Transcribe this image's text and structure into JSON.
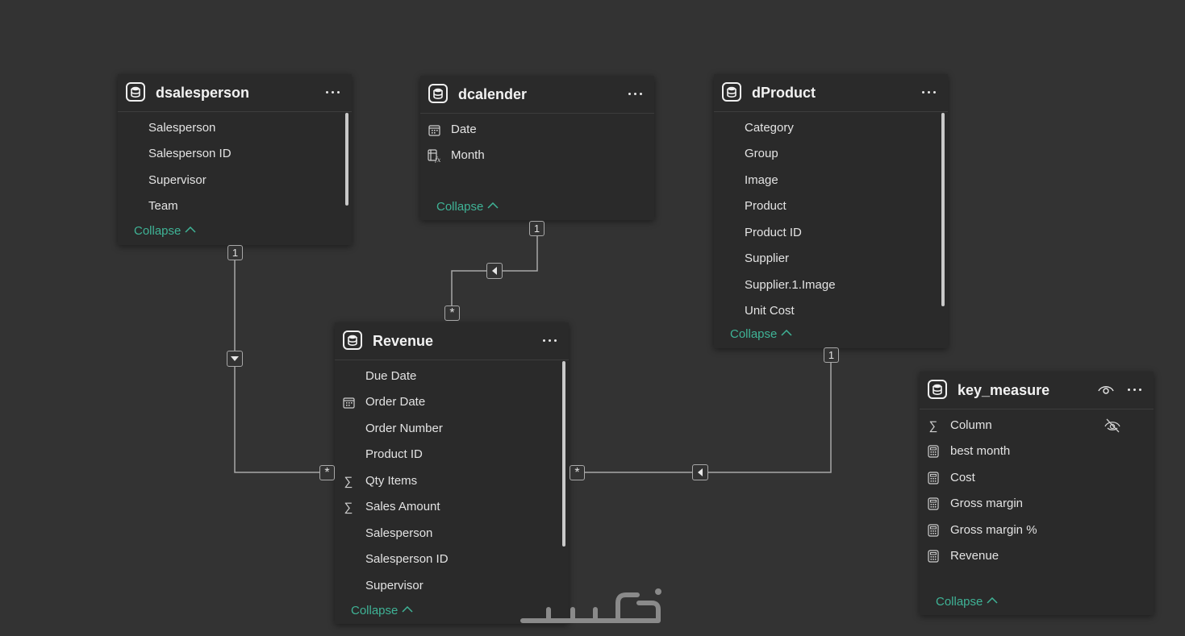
{
  "tables": {
    "dsalesperson": {
      "title": "dsalesperson",
      "fields": [
        {
          "label": "Salesperson",
          "icon": ""
        },
        {
          "label": "Salesperson ID",
          "icon": ""
        },
        {
          "label": "Supervisor",
          "icon": ""
        },
        {
          "label": "Team",
          "icon": ""
        }
      ],
      "collapse_label": "Collapse"
    },
    "dcalender": {
      "title": "dcalender",
      "fields": [
        {
          "label": "Date",
          "icon": "calendar-icon"
        },
        {
          "label": "Month",
          "icon": "calculated-column-icon"
        }
      ],
      "collapse_label": "Collapse"
    },
    "dProduct": {
      "title": "dProduct",
      "fields": [
        {
          "label": "Category",
          "icon": ""
        },
        {
          "label": "Group",
          "icon": ""
        },
        {
          "label": "Image",
          "icon": ""
        },
        {
          "label": "Product",
          "icon": ""
        },
        {
          "label": "Product ID",
          "icon": ""
        },
        {
          "label": "Supplier",
          "icon": ""
        },
        {
          "label": "Supplier.1.Image",
          "icon": ""
        },
        {
          "label": "Unit Cost",
          "icon": ""
        }
      ],
      "collapse_label": "Collapse"
    },
    "Revenue": {
      "title": "Revenue",
      "fields": [
        {
          "label": "Due Date",
          "icon": ""
        },
        {
          "label": "Order Date",
          "icon": "calendar-icon"
        },
        {
          "label": "Order Number",
          "icon": ""
        },
        {
          "label": "Product ID",
          "icon": ""
        },
        {
          "label": "Qty Items",
          "icon": "sigma-icon"
        },
        {
          "label": "Sales Amount",
          "icon": "sigma-icon"
        },
        {
          "label": "Salesperson",
          "icon": ""
        },
        {
          "label": "Salesperson ID",
          "icon": ""
        },
        {
          "label": "Supervisor",
          "icon": ""
        }
      ],
      "collapse_label": "Collapse"
    },
    "key_measure": {
      "title": "key_measure",
      "fields": [
        {
          "label": "Column",
          "icon": "sigma-icon"
        },
        {
          "label": "best month",
          "icon": "calculator-icon"
        },
        {
          "label": "Cost",
          "icon": "calculator-icon"
        },
        {
          "label": "Gross margin",
          "icon": "calculator-icon"
        },
        {
          "label": "Gross margin %",
          "icon": "calculator-icon"
        },
        {
          "label": "Revenue",
          "icon": "calculator-icon"
        }
      ],
      "collapse_label": "Collapse"
    }
  },
  "relationships": {
    "cardinality_one": "1",
    "cardinality_many": "*"
  },
  "watermark": {
    "text": "خمسات"
  },
  "colors": {
    "background": "#333333",
    "card": "#2a2a2a",
    "accent": "#3fb396",
    "line": "#a8a8a8"
  }
}
